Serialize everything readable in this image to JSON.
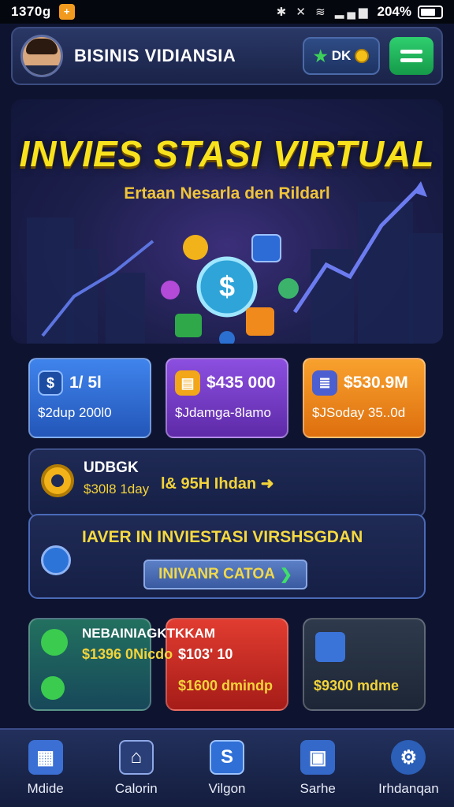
{
  "status_bar": {
    "time": "1370g",
    "battery": "204%"
  },
  "header": {
    "title": "BISINIS VIDIANSIA",
    "level_label": "DK"
  },
  "hero": {
    "title": "INVIES STASI VIRTUAL",
    "subtitle": "Ertaan Nesarla den Rildarl"
  },
  "stats": [
    {
      "top": "1/ 5l",
      "bottom": "$2dup 200l0",
      "color": "#2f6fd6"
    },
    {
      "top": "$435 000",
      "bottom": "$Jdamga-8lamo",
      "color": "#7a3fc8"
    },
    {
      "top": "$530.9M",
      "bottom": "$JSoday 35..0d",
      "color": "#f08a1c"
    }
  ],
  "business": {
    "name": "UDBGK",
    "profit": "$30l8 1day",
    "upgrade": "l& 95H Ihdan"
  },
  "investment": {
    "heading": "IAVER IN INVIESTASI VIRSHSGDAN",
    "cta": "INIVANR CATOA"
  },
  "bottom_cards": [
    {
      "title": "NEBAINIAGKTKKAM",
      "line1": "$1396 0Nicdo",
      "line2": "$103' 10"
    },
    {
      "amount": "$1600 dmindp"
    },
    {
      "amount": "$9300 mdme"
    }
  ],
  "navbar": [
    {
      "label": "Mdide",
      "icon": "shop-icon"
    },
    {
      "label": "Calorin",
      "icon": "home-icon"
    },
    {
      "label": "Vilgon",
      "icon": "money-shield-icon"
    },
    {
      "label": "Sarhe",
      "icon": "crate-icon"
    },
    {
      "label": "Irhdanqan",
      "icon": "settings-user-icon"
    }
  ]
}
